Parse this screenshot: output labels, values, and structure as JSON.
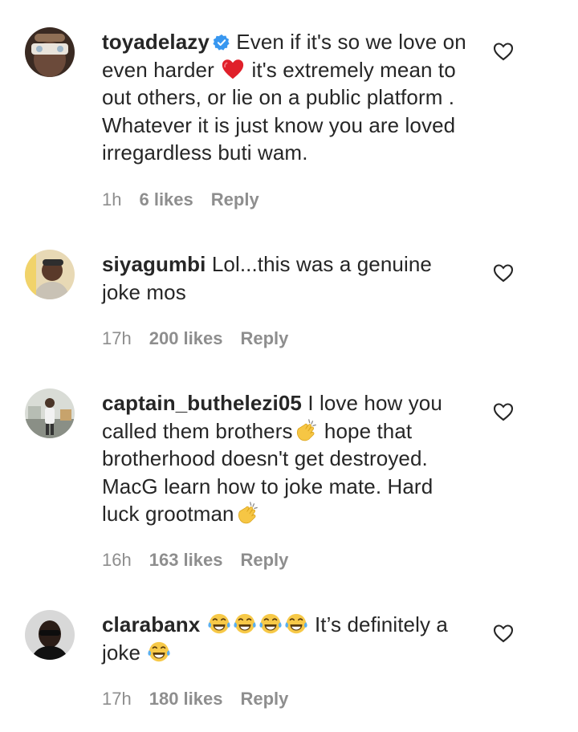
{
  "comments": [
    {
      "username": "toyadelazy",
      "verified": true,
      "text_parts": [
        "Even if it's so we love on even harder",
        "it's extremely mean to out others, or lie on a public platform . Whatever it is just know you are loved irregardless buti wam."
      ],
      "emoji": [
        "red-heart"
      ],
      "time": "1h",
      "likes": "6 likes",
      "reply": "Reply"
    },
    {
      "username": "siyagumbi",
      "verified": false,
      "text_parts": [
        "Lol...this was a genuine joke mos"
      ],
      "time": "17h",
      "likes": "200 likes",
      "reply": "Reply"
    },
    {
      "username": "captain_buthelezi05",
      "verified": false,
      "text_parts": [
        "I love how you called them brothers",
        "hope that brotherhood doesn't get destroyed. MacG learn how to joke mate. Hard luck grootman"
      ],
      "emoji": [
        "clapping-hands",
        "clapping-hands"
      ],
      "time": "16h",
      "likes": "163 likes",
      "reply": "Reply"
    },
    {
      "username": "clarabanx",
      "verified": false,
      "text_parts": [
        "It’s definitely a joke"
      ],
      "emoji": [
        "tears-of-joy",
        "tears-of-joy",
        "tears-of-joy",
        "tears-of-joy",
        "tears-of-joy"
      ],
      "time": "17h",
      "likes": "180 likes",
      "reply": "Reply"
    }
  ],
  "colors": {
    "text": "#262626",
    "meta": "#8e8e8e",
    "verified": "#3897f0",
    "heart_outline": "#262626"
  }
}
